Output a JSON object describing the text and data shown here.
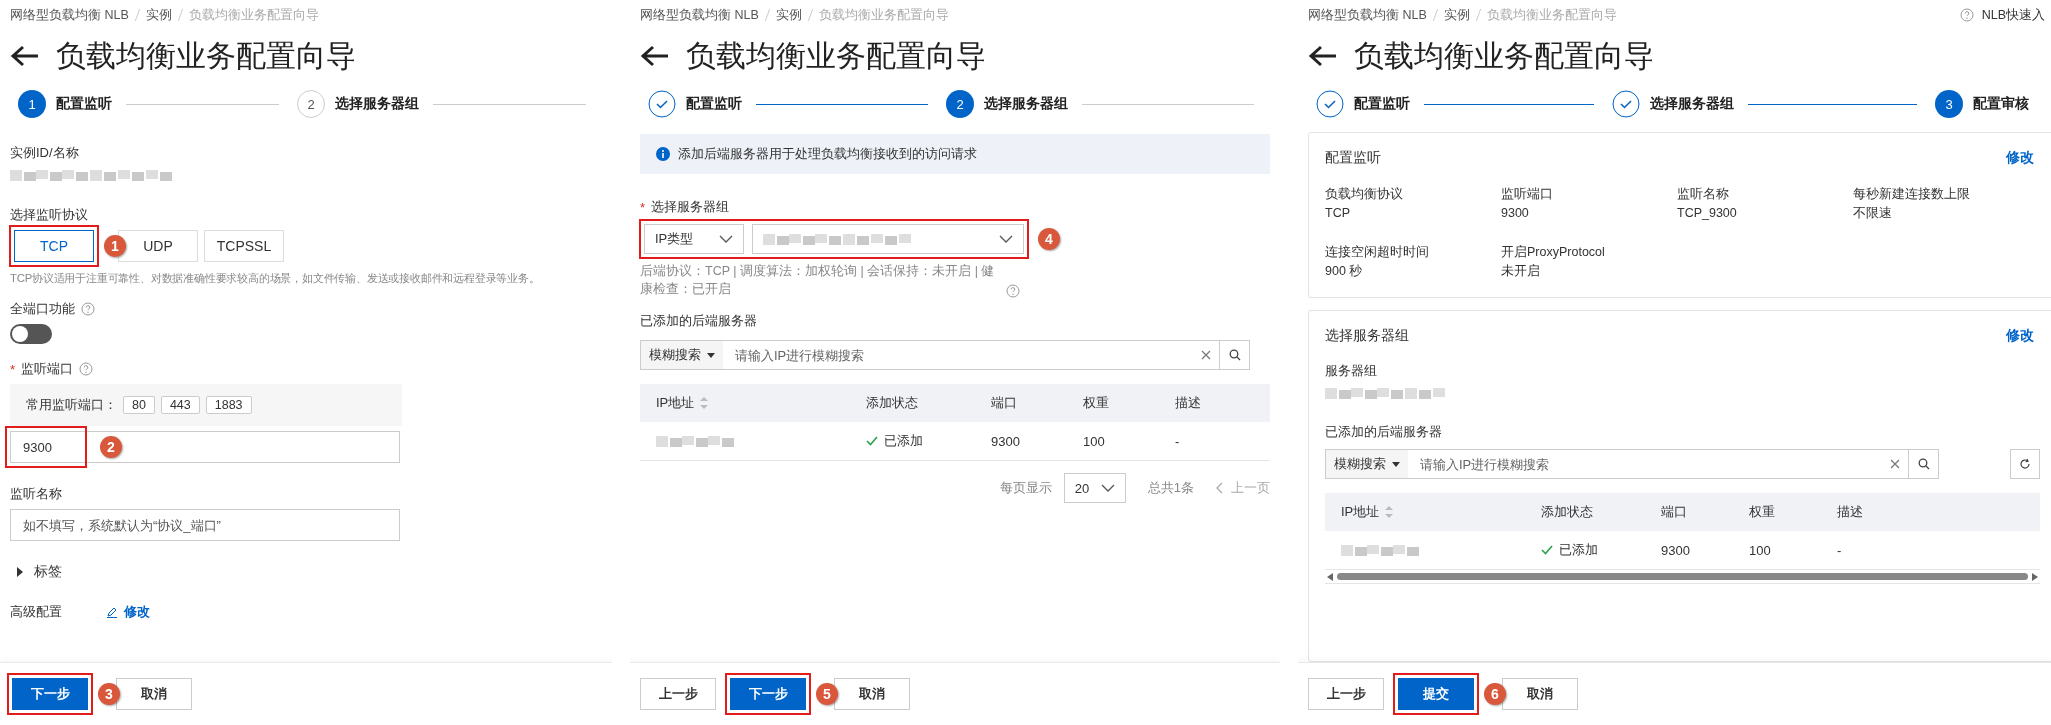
{
  "panels": [
    {
      "kind": "listener",
      "breadcrumb": [
        "网络型负载均衡 NLB",
        "实例",
        "负载均衡业务配置向导"
      ],
      "title": "负载均衡业务配置向导",
      "steps": [
        {
          "number": "1",
          "label": "配置监听",
          "selected": true,
          "done": false
        },
        {
          "number": "2",
          "label": "选择服务器组",
          "selected": false,
          "done": false
        }
      ],
      "instance_label": "实例ID/名称",
      "protocol_label": "选择监听协议",
      "protocols": [
        {
          "label": "TCP",
          "selected": true,
          "callout": "1"
        },
        {
          "label": "UDP",
          "selected": false
        },
        {
          "label": "TCPSSL",
          "selected": false
        }
      ],
      "protocol_hint": "TCP协议适用于注重可靠性、对数据准确性要求较高的场景，如文件传输、发送或接收邮件和远程登录等业务。",
      "full_port": {
        "label": "全端口功能",
        "on": false
      },
      "port": {
        "label": "监听端口",
        "required_mark": "*",
        "common_label": "常用监听端口：",
        "common_ports": [
          "80",
          "443",
          "1883"
        ],
        "value": "9300",
        "callout": "2"
      },
      "name_field": {
        "label": "监听名称",
        "placeholder": "如不填写，系统默认为“协议_端口”"
      },
      "tags": {
        "label": "标签",
        "expanded": false
      },
      "advanced": {
        "label": "高级配置",
        "link": "修改"
      },
      "buttons": [
        {
          "label": "下一步",
          "kind": "primary",
          "callout": "3"
        },
        {
          "label": "取消",
          "kind": "default"
        }
      ]
    },
    {
      "kind": "server_group",
      "breadcrumb": [
        "网络型负载均衡 NLB",
        "实例",
        "负载均衡业务配置向导"
      ],
      "title": "负载均衡业务配置向导",
      "steps": [
        {
          "label": "配置监听",
          "selected": false,
          "done": true
        },
        {
          "number": "2",
          "label": "选择服务器组",
          "selected": true,
          "done": false
        }
      ],
      "notice": "添加后端服务器用于处理负载均衡接收到的访问请求",
      "group_select": {
        "label": "选择服务器组",
        "required_mark": "*",
        "type_value": "IP类型",
        "callout": "4"
      },
      "group_info": "后端协议：TCP | 调度算法：加权轮询 | 会话保持：未开启 | 健康检查：已开启",
      "servers_label": "已添加的后端服务器",
      "search": {
        "mode": "模糊搜索",
        "placeholder": "请输入IP进行模糊搜索"
      },
      "table": {
        "columns": [
          "IP地址",
          "添加状态",
          "端口",
          "权重",
          "描述"
        ],
        "rows": [
          {
            "status": "已添加",
            "port": "9300",
            "weight": "100",
            "description": "-"
          }
        ]
      },
      "pagination": {
        "page_size_label": "每页显示",
        "page_size": "20",
        "total": "总共1条",
        "prev": "上一页",
        "prev_disabled": true
      },
      "buttons": [
        {
          "label": "上一步",
          "kind": "default"
        },
        {
          "label": "下一步",
          "kind": "primary",
          "callout": "5"
        },
        {
          "label": "取消",
          "kind": "default"
        }
      ]
    },
    {
      "kind": "review",
      "breadcrumb": [
        "网络型负载均衡 NLB",
        "实例",
        "负载均衡业务配置向导"
      ],
      "help_link": "NLB快速入",
      "title": "负载均衡业务配置向导",
      "steps": [
        {
          "label": "配置监听",
          "selected": false,
          "done": true
        },
        {
          "label": "选择服务器组",
          "selected": false,
          "done": true
        },
        {
          "number": "3",
          "label": "配置审核",
          "selected": true,
          "done": false
        }
      ],
      "listener_card": {
        "title": "配置监听",
        "edit": "修改",
        "fields": [
          {
            "label": "负载均衡协议",
            "value": "TCP"
          },
          {
            "label": "监听端口",
            "value": "9300"
          },
          {
            "label": "监听名称",
            "value": "TCP_9300"
          },
          {
            "label": "每秒新建连接数上限",
            "value": "不限速"
          },
          {
            "label": "连接空闲超时时间",
            "value": "900 秒"
          },
          {
            "label": "开启ProxyProtocol",
            "value": "未开启"
          }
        ]
      },
      "group_card": {
        "title": "选择服务器组",
        "edit": "修改",
        "group_label": "服务器组",
        "servers_label": "已添加的后端服务器",
        "search": {
          "mode": "模糊搜索",
          "placeholder": "请输入IP进行模糊搜索"
        },
        "table": {
          "columns": [
            "IP地址",
            "添加状态",
            "端口",
            "权重",
            "描述"
          ],
          "rows": [
            {
              "status": "已添加",
              "port": "9300",
              "weight": "100",
              "description": "-"
            }
          ]
        }
      },
      "buttons": [
        {
          "label": "上一步",
          "kind": "default"
        },
        {
          "label": "提交",
          "kind": "primary",
          "callout": "6"
        },
        {
          "label": "取消",
          "kind": "default"
        }
      ]
    }
  ]
}
